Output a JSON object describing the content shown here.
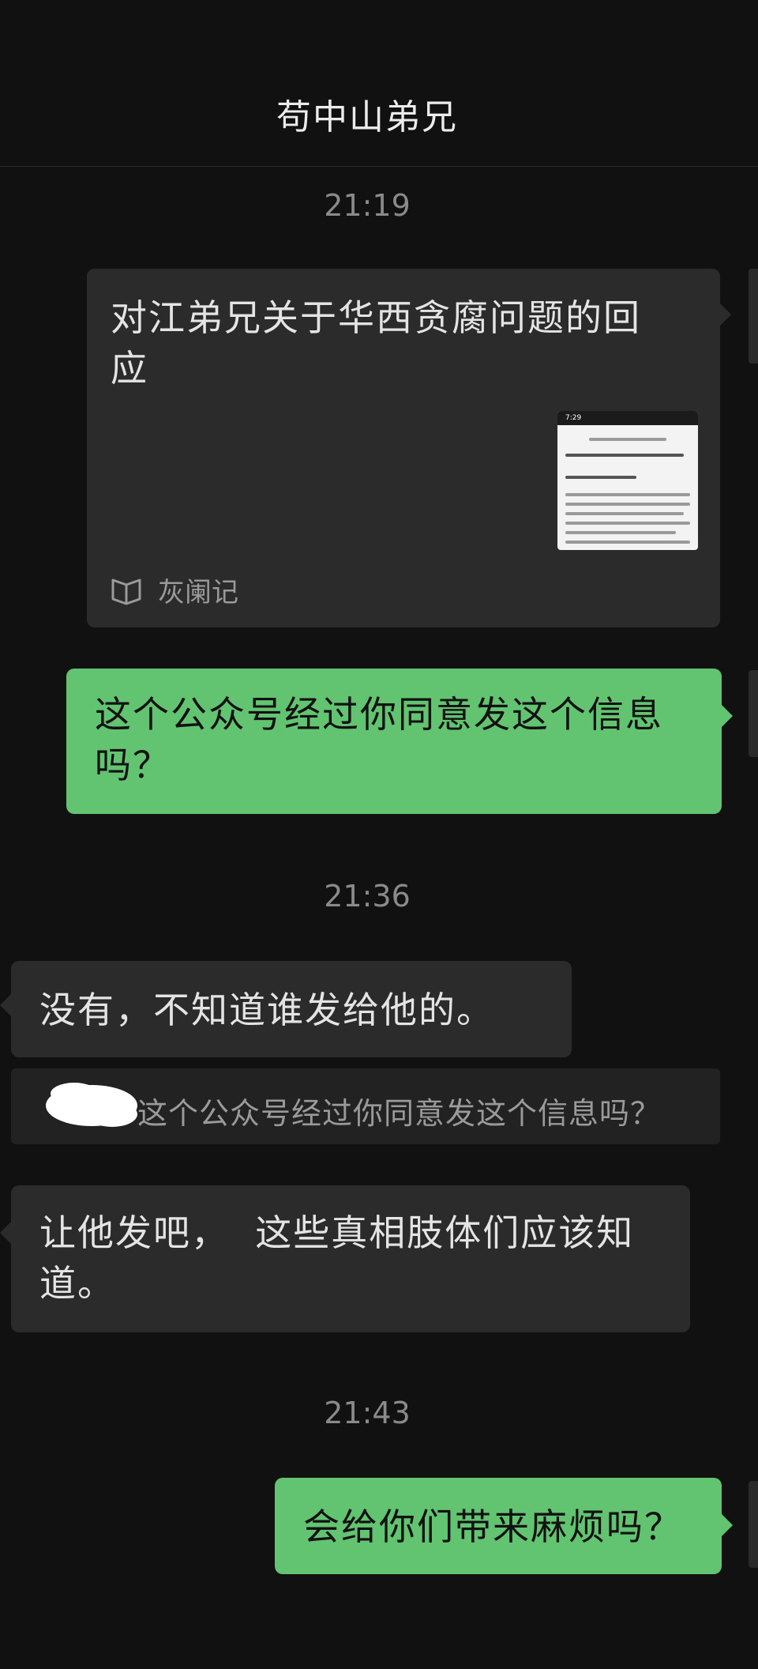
{
  "header": {
    "title": "苟中山弟兄"
  },
  "timestamps": [
    "21:19",
    "21:36",
    "21:43"
  ],
  "messages": {
    "article": {
      "title_line1": "对江弟兄关于华西贪腐问题的回",
      "title_line2": "应",
      "source": "灰阑记",
      "thumb_time": "7:29"
    },
    "q1_line1": "这个公众号经过你同意发这个信息",
    "q1_line2": "吗？",
    "r1": "没有，不知道谁发给他的。",
    "quote": "这个公众号经过你同意发这个信息吗？",
    "r2_line1": "让他发吧，  这些真相肢体们应该知",
    "r2_line2": "道。",
    "q2": "会给你们带来麻烦吗？"
  },
  "colors": {
    "background": "#111111",
    "incoming_bubble": "#2b2b2b",
    "outgoing_bubble": "#62c371",
    "timestamp": "#8a8a8a"
  }
}
